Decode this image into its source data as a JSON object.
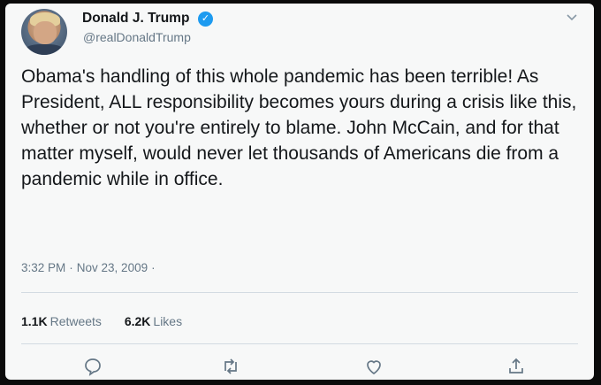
{
  "tweet": {
    "author_name": "Donald J. Trump",
    "handle": "@realDonaldTrump",
    "verified_icon": "verified-badge-icon",
    "text": "Obama's handling of this whole pandemic has been terrible! As President, ALL responsibility becomes yours during a crisis like this, whether or not you're entirely to blame. John McCain, and for that matter myself, would never let thousands of Americans die from a pandemic while in office.",
    "time": "3:32 PM",
    "date": "Nov 23, 2009",
    "retweet_count": "1.1K",
    "retweet_label": "Retweets",
    "like_count": "6.2K",
    "like_label": "Likes"
  },
  "colors": {
    "accent": "#1d9bf0",
    "text": "#14171a",
    "secondary": "#657786",
    "card_bg": "#f7f8f8"
  },
  "actions": [
    "reply-icon",
    "retweet-icon",
    "like-icon",
    "share-icon"
  ]
}
